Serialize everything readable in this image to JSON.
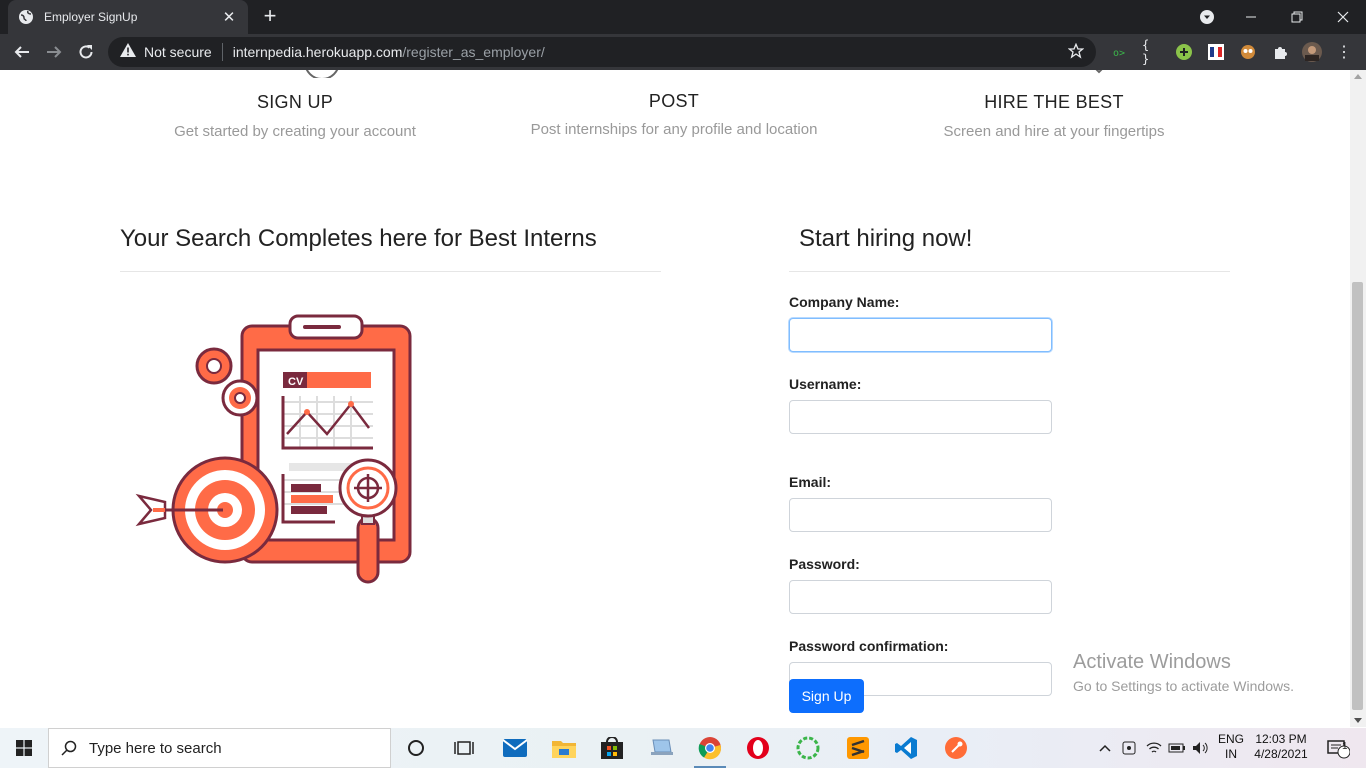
{
  "browser": {
    "tab_title": "Employer SignUp",
    "omnibox": {
      "security_label": "Not secure",
      "url_host": "internpedia.herokuapp.com",
      "url_path": "/register_as_employer/"
    }
  },
  "features": [
    {
      "title": "SIGN UP",
      "subtitle": "Get started by creating your account"
    },
    {
      "title": "POST",
      "subtitle": "Post internships for any profile and location"
    },
    {
      "title": "HIRE THE BEST",
      "subtitle": "Screen and hire at your fingertips"
    }
  ],
  "left_section": {
    "title": "Your Search Completes here for Best Interns",
    "illustration_text": "CV"
  },
  "form": {
    "title": "Start hiring now!",
    "fields": [
      {
        "label": "Company Name:",
        "value": ""
      },
      {
        "label": "Username:",
        "value": ""
      },
      {
        "label": "Email:",
        "value": ""
      },
      {
        "label": "Password:",
        "value": ""
      },
      {
        "label": "Password confirmation:",
        "value": ""
      }
    ],
    "submit_label": "Sign Up"
  },
  "watermark": {
    "line1": "Activate Windows",
    "line2": "Go to Settings to activate Windows."
  },
  "taskbar": {
    "search_placeholder": "Type here to search",
    "language": "ENG",
    "region": "IN",
    "time": "12:03 PM",
    "date": "4/28/2021",
    "notification_count": "1"
  },
  "colors": {
    "primary_button": "#0d6efd",
    "illustration_orange": "#ff6b47",
    "illustration_dark": "#7a2a3e"
  }
}
